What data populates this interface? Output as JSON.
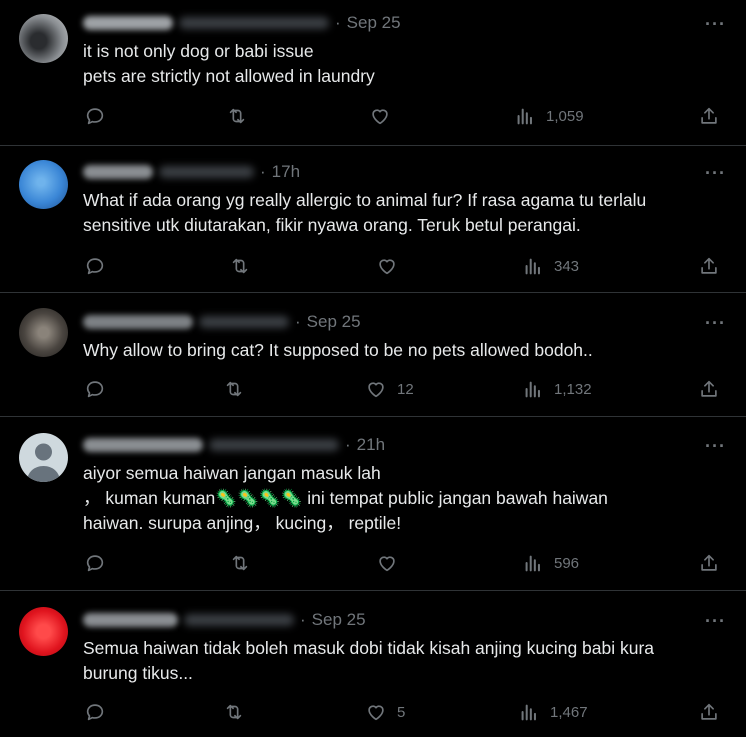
{
  "tweets": [
    {
      "time": "Sep 25",
      "text": "it is not only dog or babi issue\npets are strictly not allowed in laundry",
      "likes": "",
      "views": "1,059",
      "avatar_color": "#6b6f73"
    },
    {
      "time": "17h",
      "text": "What if ada orang yg really allergic to animal fur? If rasa agama tu terlalu sensitive utk diutarakan, fikir nyawa orang. Teruk betul perangai.",
      "likes": "",
      "views": "343",
      "avatar_color": "#3a86d6"
    },
    {
      "time": "Sep 25",
      "text": "Why allow to bring cat? It supposed to be no pets allowed bodoh..",
      "likes": "12",
      "views": "1,132",
      "avatar_color": "#5a5550"
    },
    {
      "time": "21h",
      "text": "aiyor semua haiwan jangan masuk lah\n，  kuman kuman🦠🦠🦠🦠 ini tempat public jangan bawah haiwan\nhaiwan. surupa anjing，  kucing，  reptile!",
      "likes": "",
      "views": "596",
      "avatar_color": "#cfd9de"
    },
    {
      "time": "Sep 25",
      "text": "Semua haiwan tidak boleh masuk dobi tidak kisah anjing kucing babi kura\nburung tikus...",
      "likes": "5",
      "views": "1,467",
      "avatar_color": "#e0141e"
    }
  ],
  "separator": "·",
  "more_glyph": "···",
  "icons": [
    "reply-icon",
    "retweet-icon",
    "like-icon",
    "views-icon",
    "share-icon",
    "more-icon"
  ]
}
